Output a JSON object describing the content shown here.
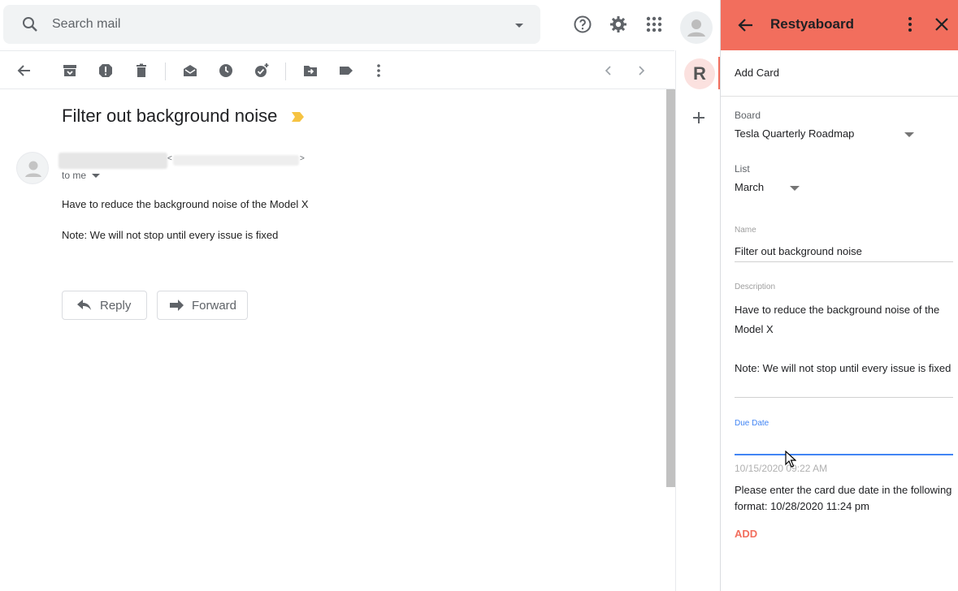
{
  "search": {
    "placeholder": "Search mail"
  },
  "email": {
    "subject": "Filter out background noise",
    "to_me": "to me",
    "sender_lt": "<",
    "sender_gt": ">",
    "body": [
      "Have to reduce the background noise of the Model X",
      "Note: We will not stop until every issue is fixed"
    ],
    "reply_label": "Reply",
    "forward_label": "Forward",
    "label_color": "#f6c342"
  },
  "rail": {
    "app_letter": "R"
  },
  "panel": {
    "title": "Restyaboard",
    "header_color": "#f26e5d",
    "add_card": "Add Card",
    "board_label": "Board",
    "board_value": "Tesla Quarterly Roadmap",
    "list_label": "List",
    "list_value": "March",
    "name_label": "Name",
    "name_value": "Filter out background noise",
    "description_label": "Description",
    "description_lines": [
      "Have to reduce the background noise of the Model X",
      "Note: We will not stop until every issue is fixed"
    ],
    "due_label": "Due Date",
    "due_placeholder": "10/15/2020 09:22 AM",
    "due_help": "Please enter the card due date in the following format: 10/28/2020 11:24 pm",
    "add_button": "ADD"
  },
  "icons": [
    "search-icon",
    "dropdown-caret-icon",
    "help-icon",
    "settings-icon",
    "apps-grid-icon",
    "account-avatar-icon",
    "back-arrow-icon",
    "archive-icon",
    "report-spam-icon",
    "delete-icon",
    "mark-unread-icon",
    "snooze-icon",
    "add-task-icon",
    "move-to-icon",
    "labels-icon",
    "more-vert-icon",
    "prev-chevron-icon",
    "next-chevron-icon",
    "reply-icon",
    "forward-icon",
    "plus-icon",
    "close-icon"
  ]
}
